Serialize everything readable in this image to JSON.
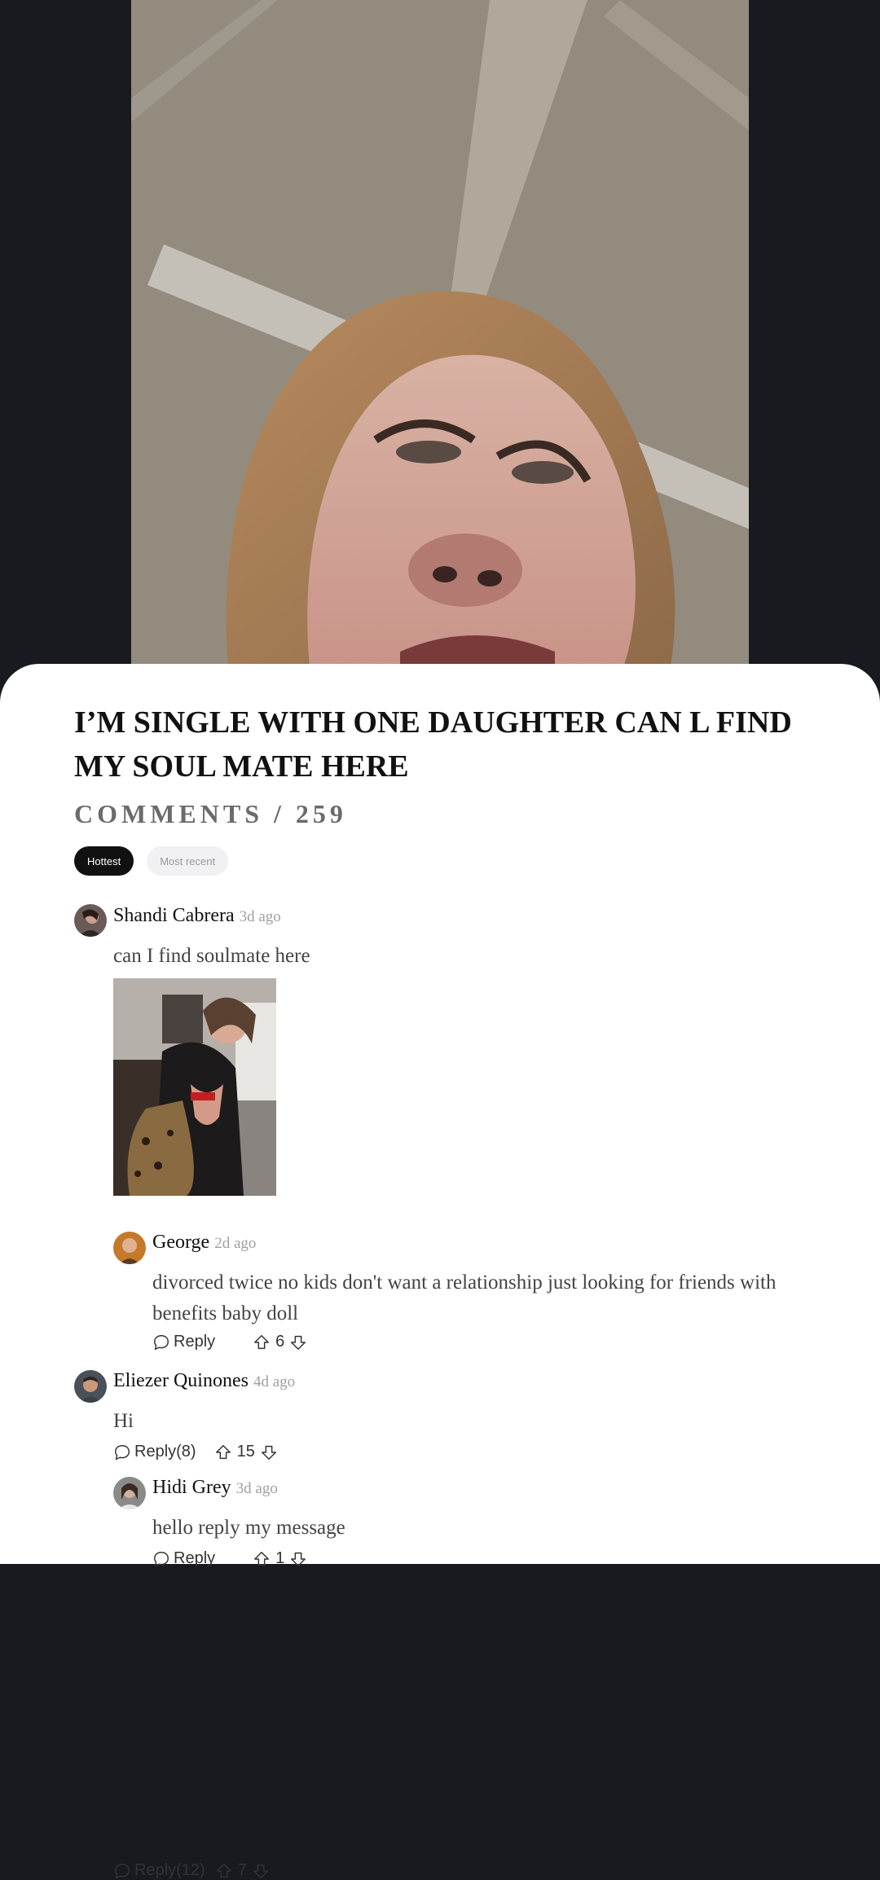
{
  "post": {
    "title": "I’M SINGLE WITH ONE DAUGHTER CAN L FIND MY SOUL MATE HERE"
  },
  "comments_header": "COMMENTS / 259",
  "tabs": [
    {
      "label": "Hottest",
      "active": true
    },
    {
      "label": "Most recent",
      "active": false
    }
  ],
  "comments": [
    {
      "author": "Shandi Cabrera",
      "time": "3d ago",
      "text": "can I find soulmate here",
      "reply_label": "Reply(12)",
      "votes": "7",
      "has_photo": true,
      "replies": [
        {
          "author": "George",
          "time": "2d ago",
          "text": "divorced twice no kids don't want a relationship just looking for friends with benefits baby doll",
          "reply_label": "Reply",
          "votes": "6"
        }
      ]
    },
    {
      "author": "Eliezer Quinones",
      "time": "4d ago",
      "text": "Hi",
      "reply_label": "Reply(8)",
      "votes": "15",
      "replies": [
        {
          "author": "Hidi Grey",
          "time": "3d ago",
          "text": "hello reply my message",
          "reply_label": "Reply",
          "votes": "1"
        }
      ]
    }
  ],
  "icons": {
    "reply": "speech-bubble-icon",
    "upvote": "arrow-up-outline-icon",
    "downvote": "arrow-down-outline-icon"
  },
  "colors": {
    "background": "#191a20",
    "sheet": "#ffffff",
    "tab_active": "#111111",
    "tab_inactive": "#f1f1f3"
  }
}
